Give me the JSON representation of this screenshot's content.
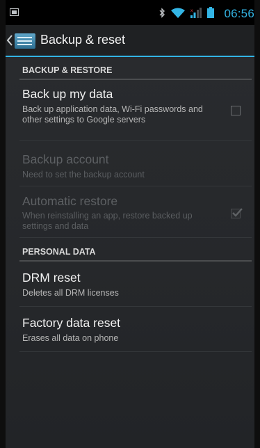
{
  "status_bar": {
    "time": "06:56",
    "accent_color": "#33b5e5",
    "icons": [
      "notification-icon",
      "bluetooth-icon",
      "wifi-icon",
      "signal-icon",
      "battery-icon"
    ]
  },
  "action_bar": {
    "title": "Backup & reset",
    "up_icon": "chevron-left-icon",
    "app_icon": "settings-icon"
  },
  "sections": {
    "backup": {
      "header": "BACKUP & RESTORE"
    },
    "personal": {
      "header": "PERSONAL DATA"
    }
  },
  "items": {
    "backup_data": {
      "title": "Back up my data",
      "summary": "Back up application data, Wi-Fi passwords and other settings to Google servers",
      "checked": false,
      "enabled": true
    },
    "backup_account": {
      "title": "Backup account",
      "summary": "Need to set the backup account",
      "enabled": false
    },
    "auto_restore": {
      "title": "Automatic restore",
      "summary": "When reinstalling an app, restore backed up settings and data",
      "checked": true,
      "enabled": false
    },
    "drm_reset": {
      "title": "DRM reset",
      "summary": "Deletes all DRM licenses",
      "enabled": true
    },
    "factory_reset": {
      "title": "Factory data reset",
      "summary": "Erases all data on phone",
      "enabled": true
    }
  }
}
